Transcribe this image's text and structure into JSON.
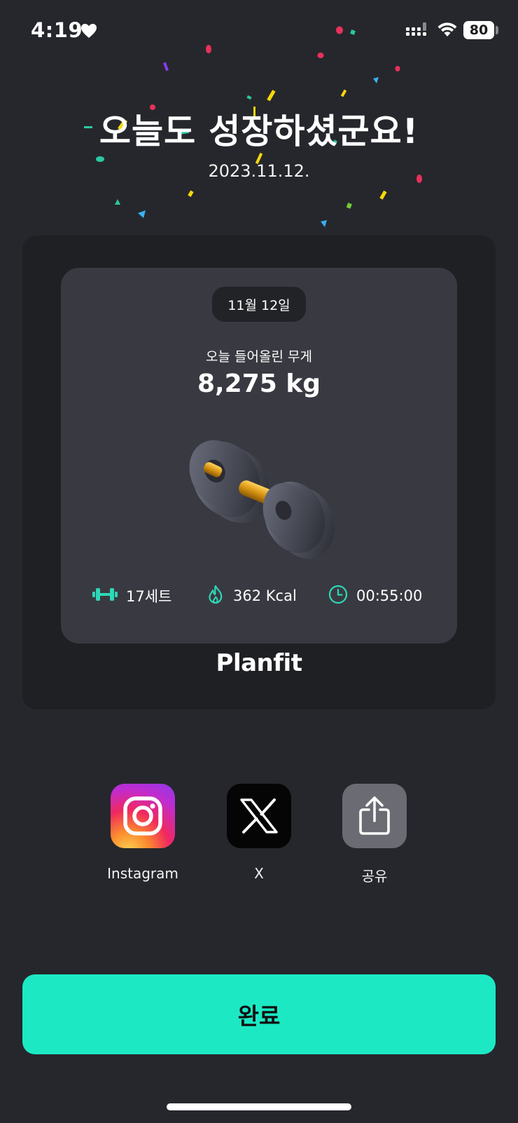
{
  "status_bar": {
    "time": "4:19",
    "battery": "80",
    "heart_icon": "heart-icon",
    "signal_icon": "cellular-signal-icon",
    "wifi_icon": "wifi-icon"
  },
  "header": {
    "title": "오늘도 성장하셨군요!",
    "date": "2023.11.12."
  },
  "card": {
    "date_pill": "11월 12일",
    "weight_label": "오늘 들어올린 무게",
    "weight_value": "8,275 kg",
    "image_icon": "dumbbell-icon",
    "stats": {
      "sets": "17세트",
      "kcal": "362 Kcal",
      "duration": "00:55:00"
    },
    "brand": "Planfit"
  },
  "share": {
    "options": [
      {
        "label": "Instagram",
        "icon": "instagram-icon"
      },
      {
        "label": "X",
        "icon": "x-logo-icon"
      },
      {
        "label": "공유",
        "icon": "share-icon"
      }
    ]
  },
  "actions": {
    "done_label": "완료"
  },
  "colors": {
    "background": "#26272c",
    "card_outer": "#1f2024",
    "card_inner": "#393a41",
    "accent": "#1ce9c4",
    "stat_icon": "#2ed8b8"
  }
}
